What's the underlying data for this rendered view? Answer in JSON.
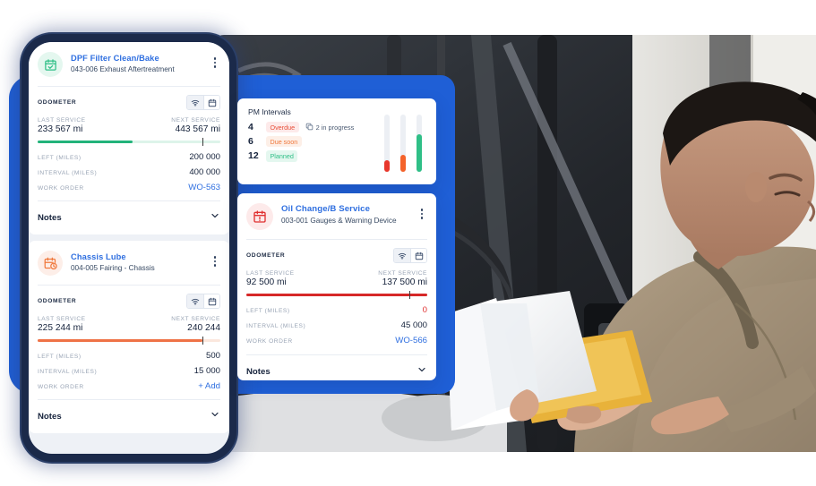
{
  "photo": {
    "alt": "mechanic-inspecting-engine",
    "description": "Technician in tan work jacket reviewing paperwork on a clipboard in front of an open truck engine bay"
  },
  "phone": {
    "cards": [
      {
        "id": "dpf-filter-clean-bake",
        "status": "green",
        "icon": "calendar-check-icon",
        "title": "DPF Filter Clean/Bake",
        "subtitle": "043-006 Exhaust Aftertreatment",
        "meter_label": "ODOMETER",
        "toggles": [
          {
            "icon": "signal-icon",
            "active": true
          },
          {
            "icon": "calendar-icon",
            "active": false
          }
        ],
        "last_service_label": "LAST SERVICE",
        "last_service_value": "233 567 mi",
        "next_service_label": "NEXT SERVICE",
        "next_service_value": "443 567 mi",
        "progress_percent": 52,
        "marker_percent": 90,
        "rows": [
          {
            "key": "LEFT (MILES)",
            "value": "200 000",
            "style": "plain"
          },
          {
            "key": "INTERVAL (MILES)",
            "value": "400 000",
            "style": "plain"
          },
          {
            "key": "WORK ORDER",
            "value": "WO-563",
            "style": "link"
          }
        ],
        "notes_label": "Notes",
        "notes_chevron": "chevron-down-icon"
      },
      {
        "id": "chassis-lube",
        "status": "orange",
        "icon": "calendar-clock-icon",
        "title": "Chassis Lube",
        "subtitle": "004-005 Fairing - Chassis",
        "meter_label": "ODOMETER",
        "toggles": [
          {
            "icon": "signal-icon",
            "active": true
          },
          {
            "icon": "calendar-icon",
            "active": false
          }
        ],
        "last_service_label": "LAST SERVICE",
        "last_service_value": "225 244 mi",
        "next_service_label": "NEXT SERVICE",
        "next_service_value": "240 244",
        "progress_percent": 90,
        "marker_percent": 90,
        "rows": [
          {
            "key": "LEFT (MILES)",
            "value": "500",
            "style": "plain"
          },
          {
            "key": "INTERVAL (MILES)",
            "value": "15 000",
            "style": "plain"
          },
          {
            "key": "WORK ORDER",
            "value": "+ Add",
            "style": "add"
          }
        ],
        "notes_label": "Notes",
        "notes_chevron": "chevron-down-icon"
      }
    ]
  },
  "pm_intervals": {
    "title": "PM Intervals",
    "rows": [
      {
        "count": "4",
        "label": "Overdue",
        "style": "overdue",
        "extra_icon": "in-progress-icon",
        "extra_text": "2 in progress"
      },
      {
        "count": "6",
        "label": "Due soon",
        "style": "duesoon",
        "extra_icon": null,
        "extra_text": null
      },
      {
        "count": "12",
        "label": "Planned",
        "style": "planned",
        "extra_icon": null,
        "extra_text": null
      }
    ]
  },
  "oil_card": {
    "id": "oil-change-b-service",
    "status": "red",
    "icon": "calendar-alert-icon",
    "title": "Oil Change/B Service",
    "subtitle": "003-001 Gauges & Warning Device",
    "meter_label": "ODOMETER",
    "toggles": [
      {
        "icon": "signal-icon",
        "active": true
      },
      {
        "icon": "calendar-icon",
        "active": false
      }
    ],
    "last_service_label": "LAST SERVICE",
    "last_service_value": "92 500 mi",
    "next_service_label": "NEXT SERVICE",
    "next_service_value": "137 500 mi",
    "progress_percent": 100,
    "marker_percent": 90,
    "rows": [
      {
        "key": "LEFT (MILES)",
        "value": "0",
        "style": "red"
      },
      {
        "key": "INTERVAL (MILES)",
        "value": "45 000",
        "style": "plain"
      },
      {
        "key": "WORK ORDER",
        "value": "WO-566",
        "style": "link"
      }
    ],
    "notes_label": "Notes",
    "notes_chevron": "chevron-down-icon"
  },
  "chart_data": {
    "type": "bar",
    "title": "PM Intervals",
    "categories": [
      "Overdue",
      "Due soon",
      "Planned"
    ],
    "values": [
      4,
      6,
      12
    ],
    "fill_percent": [
      20,
      30,
      65
    ],
    "colors": [
      "#e8372c",
      "#f4622a",
      "#2fbf87"
    ],
    "annotations": [
      "2 in progress"
    ],
    "xlabel": "",
    "ylabel": "",
    "legend": "none",
    "grid": false
  },
  "colors": {
    "brand_blue": "#2f6fe0",
    "panel_blue": "#1f5fd6",
    "phone_frame": "#1b2a4a",
    "green": "#2fbf87",
    "orange": "#f0793d",
    "red": "#e03131",
    "muted": "#9aa5b6",
    "ink": "#16233c"
  }
}
